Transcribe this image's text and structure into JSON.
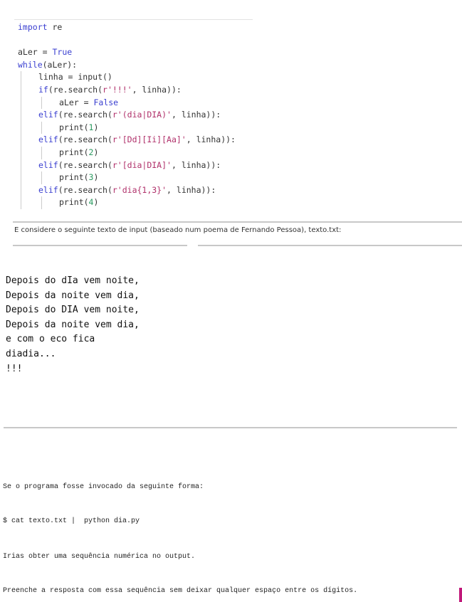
{
  "code": [
    {
      "indent": 0,
      "tokens": [
        {
          "t": "import",
          "c": "kw"
        },
        {
          "t": " re",
          "c": "tx"
        }
      ]
    },
    {
      "indent": 0,
      "tokens": []
    },
    {
      "indent": 0,
      "tokens": [
        {
          "t": "aLer = ",
          "c": "tx"
        },
        {
          "t": "True",
          "c": "kw"
        }
      ]
    },
    {
      "indent": 0,
      "tokens": [
        {
          "t": "while",
          "c": "kw"
        },
        {
          "t": "(aLer):",
          "c": "tx"
        }
      ]
    },
    {
      "indent": 1,
      "tokens": [
        {
          "t": "linha = input()",
          "c": "tx"
        }
      ]
    },
    {
      "indent": 1,
      "tokens": [
        {
          "t": "if",
          "c": "kw"
        },
        {
          "t": "(re.search(",
          "c": "tx"
        },
        {
          "t": "r'!!!'",
          "c": "st"
        },
        {
          "t": ", linha)):",
          "c": "tx"
        }
      ]
    },
    {
      "indent": 2,
      "tokens": [
        {
          "t": "aLer = ",
          "c": "tx"
        },
        {
          "t": "False",
          "c": "kw"
        }
      ]
    },
    {
      "indent": 1,
      "tokens": [
        {
          "t": "elif",
          "c": "kw"
        },
        {
          "t": "(re.search(",
          "c": "tx"
        },
        {
          "t": "r'(dia|DIA)'",
          "c": "st"
        },
        {
          "t": ", linha)):",
          "c": "tx"
        }
      ]
    },
    {
      "indent": 2,
      "tokens": [
        {
          "t": "print(",
          "c": "tx"
        },
        {
          "t": "1",
          "c": "nu"
        },
        {
          "t": ")",
          "c": "tx"
        }
      ]
    },
    {
      "indent": 1,
      "tokens": [
        {
          "t": "elif",
          "c": "kw"
        },
        {
          "t": "(re.search(",
          "c": "tx"
        },
        {
          "t": "r'[Dd][Ii][Aa]'",
          "c": "st"
        },
        {
          "t": ", linha)):",
          "c": "tx"
        }
      ]
    },
    {
      "indent": 2,
      "tokens": [
        {
          "t": "print(",
          "c": "tx"
        },
        {
          "t": "2",
          "c": "nu"
        },
        {
          "t": ")",
          "c": "tx"
        }
      ]
    },
    {
      "indent": 1,
      "tokens": [
        {
          "t": "elif",
          "c": "kw"
        },
        {
          "t": "(re.search(",
          "c": "tx"
        },
        {
          "t": "r'[dia|DIA]'",
          "c": "st"
        },
        {
          "t": ", linha)):",
          "c": "tx"
        }
      ]
    },
    {
      "indent": 2,
      "tokens": [
        {
          "t": "print(",
          "c": "tx"
        },
        {
          "t": "3",
          "c": "nu"
        },
        {
          "t": ")",
          "c": "tx"
        }
      ]
    },
    {
      "indent": 1,
      "tokens": [
        {
          "t": "elif",
          "c": "kw"
        },
        {
          "t": "(re.search(",
          "c": "tx"
        },
        {
          "t": "r'dia{1,3}'",
          "c": "st"
        },
        {
          "t": ", linha)):",
          "c": "tx"
        }
      ]
    },
    {
      "indent": 2,
      "tokens": [
        {
          "t": "print(",
          "c": "tx"
        },
        {
          "t": "4",
          "c": "nu"
        },
        {
          "t": ")",
          "c": "tx"
        }
      ]
    }
  ],
  "intro": "E considere o seguinte texto de input (baseado num poema de Fernando Pessoa), texto.txt:",
  "poem": [
    "Depois do dIa vem noite,",
    "Depois da noite vem dia,",
    "Depois do DIA vem noite,",
    "Depois da noite vem dia,",
    "e com o eco fica",
    "diadia...",
    "!!!"
  ],
  "question": {
    "invocation_label": "Se o programa fosse invocado da seguinte forma:",
    "command": "$ cat texto.txt |  python dia.py",
    "output_note": "Irias obter uma sequência numérica no output.",
    "instruction": "Preenche a resposta com essa sequência sem deixar qualquer espaço entre os dígitos."
  },
  "colors": {
    "keyword": "#3a3fd0",
    "string": "#b0306a",
    "number": "#2a9a60",
    "cursor": "#c0187a"
  }
}
